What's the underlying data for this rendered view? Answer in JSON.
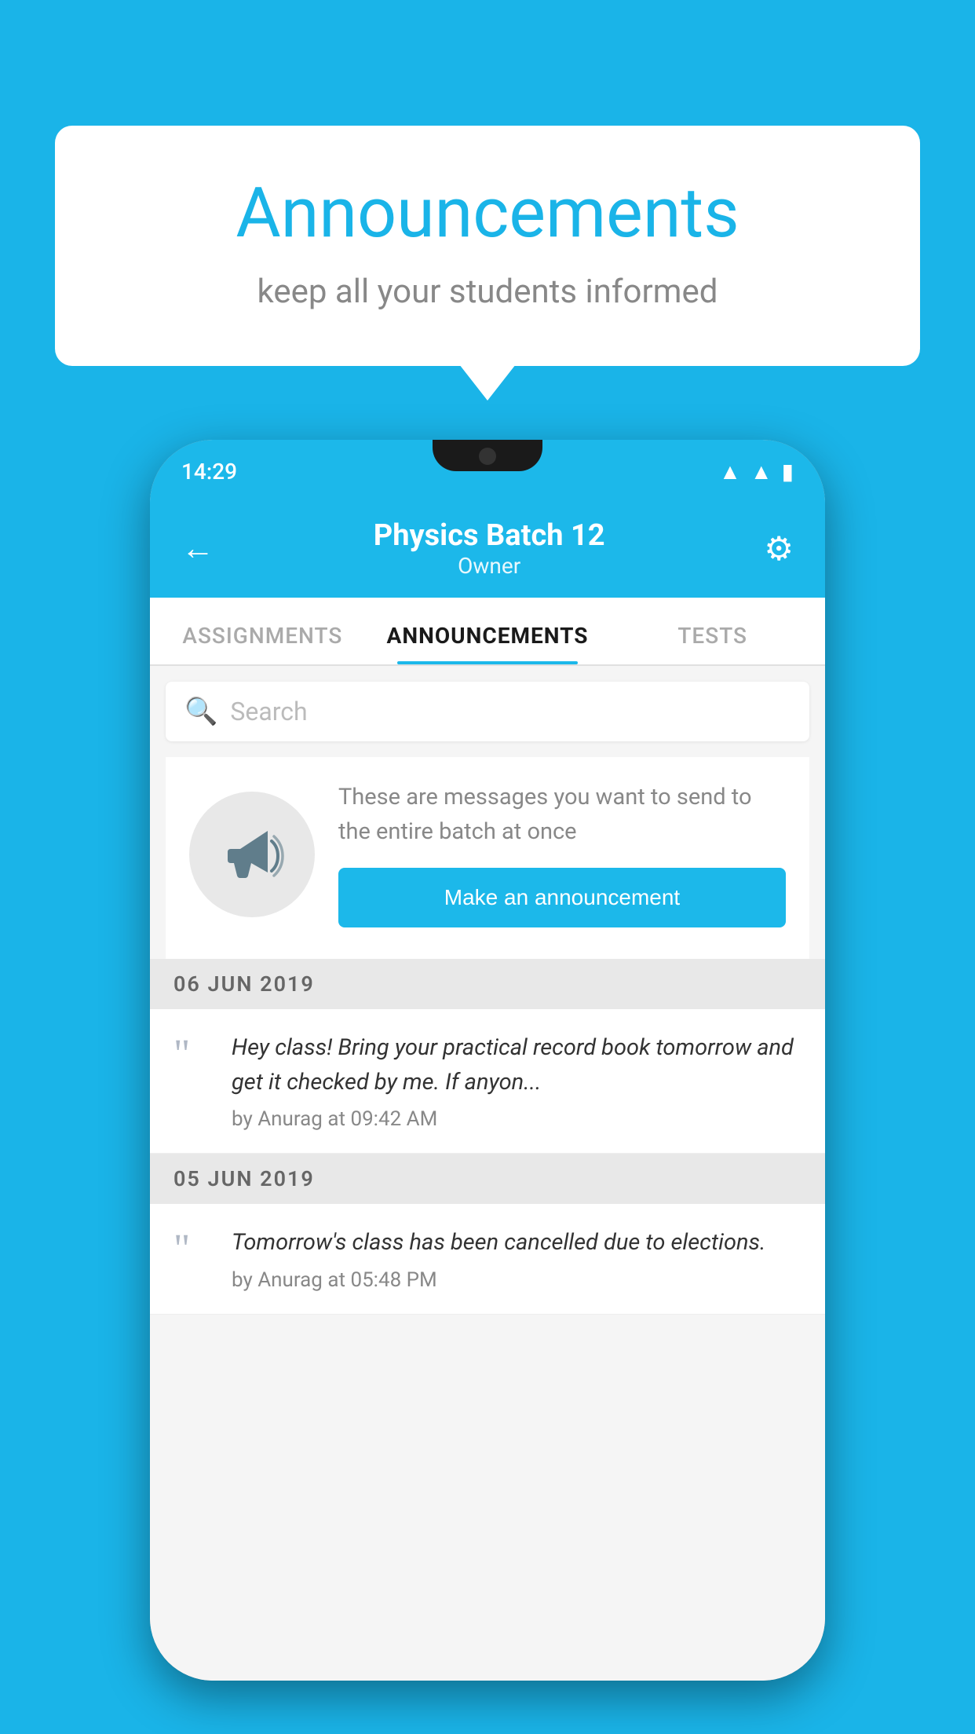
{
  "background_color": "#1ab4e8",
  "speech_bubble": {
    "title": "Announcements",
    "subtitle": "keep all your students informed"
  },
  "phone": {
    "status_bar": {
      "time": "14:29"
    },
    "header": {
      "back_label": "←",
      "title": "Physics Batch 12",
      "subtitle": "Owner",
      "gear_label": "⚙"
    },
    "tabs": [
      {
        "label": "ASSIGNMENTS",
        "active": false
      },
      {
        "label": "ANNOUNCEMENTS",
        "active": true
      },
      {
        "label": "TESTS",
        "active": false
      }
    ],
    "search": {
      "placeholder": "Search"
    },
    "promo": {
      "text": "These are messages you want to send to the entire batch at once",
      "button_label": "Make an announcement"
    },
    "announcements": [
      {
        "date": "06  JUN  2019",
        "items": [
          {
            "text": "Hey class! Bring your practical record book tomorrow and get it checked by me. If anyon...",
            "meta": "by Anurag at 09:42 AM"
          }
        ]
      },
      {
        "date": "05  JUN  2019",
        "items": [
          {
            "text": "Tomorrow's class has been cancelled due to elections.",
            "meta": "by Anurag at 05:48 PM"
          }
        ]
      }
    ]
  }
}
